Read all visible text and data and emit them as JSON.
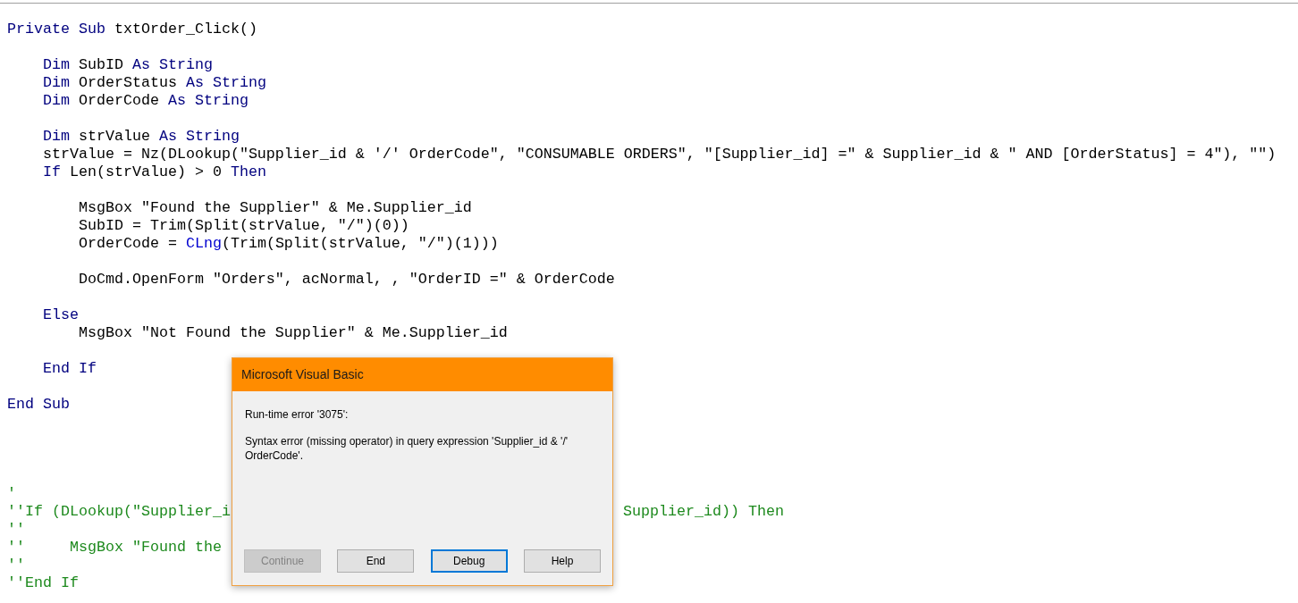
{
  "code": {
    "blocks": [
      [
        [
          {
            "kind": "keyword",
            "text": "Private Sub"
          },
          {
            "kind": "plain",
            "text": " txtOrder_Click()"
          }
        ]
      ],
      [
        [
          {
            "kind": "keyword",
            "text": "    Dim"
          },
          {
            "kind": "plain",
            "text": " SubID "
          },
          {
            "kind": "keyword",
            "text": "As String"
          }
        ],
        [
          {
            "kind": "keyword",
            "text": "    Dim"
          },
          {
            "kind": "plain",
            "text": " OrderStatus "
          },
          {
            "kind": "keyword",
            "text": "As String"
          }
        ],
        [
          {
            "kind": "keyword",
            "text": "    Dim"
          },
          {
            "kind": "plain",
            "text": " OrderCode "
          },
          {
            "kind": "keyword",
            "text": "As String"
          }
        ]
      ],
      [
        [
          {
            "kind": "keyword",
            "text": "    Dim"
          },
          {
            "kind": "plain",
            "text": " strValue "
          },
          {
            "kind": "keyword",
            "text": "As String"
          }
        ],
        [
          {
            "kind": "plain",
            "text": "    strValue = Nz(DLookup(\"Supplier_id & '/' OrderCode\", \"CONSUMABLE ORDERS\", \"[Supplier_id] =\" & Supplier_id & \" AND [OrderStatus] = 4\"), \"\")"
          }
        ],
        [
          {
            "kind": "keyword",
            "text": "    If"
          },
          {
            "kind": "plain",
            "text": " Len(strValue) > 0 "
          },
          {
            "kind": "keyword",
            "text": "Then"
          }
        ]
      ],
      [
        [
          {
            "kind": "plain",
            "text": "        MsgBox \"Found the Supplier\" & Me.Supplier_id"
          }
        ],
        [
          {
            "kind": "plain",
            "text": "        SubID = Trim(Split(strValue, \"/\")(0))"
          }
        ],
        [
          {
            "kind": "plain",
            "text": "        OrderCode = "
          },
          {
            "kind": "builtin",
            "text": "CLng"
          },
          {
            "kind": "plain",
            "text": "(Trim(Split(strValue, \"/\")(1)))"
          }
        ]
      ],
      [
        [
          {
            "kind": "plain",
            "text": "        DoCmd.OpenForm \"Orders\", acNormal, , \"OrderID =\" & OrderCode"
          }
        ]
      ],
      [
        [
          {
            "kind": "keyword",
            "text": "    Else"
          }
        ],
        [
          {
            "kind": "plain",
            "text": "        MsgBox \"Not Found the Supplier\" & Me.Supplier_id"
          }
        ]
      ],
      [
        [
          {
            "kind": "keyword",
            "text": "    End If"
          }
        ]
      ],
      [
        [
          {
            "kind": "keyword",
            "text": "End Sub"
          }
        ]
      ]
    ],
    "comment_lines": [
      {
        "segments": [
          "'"
        ]
      },
      {
        "segments": [
          "''If (DLookup(\"Supplier_i",
          "Supplier_id)) Then"
        ]
      },
      {
        "segments": [
          "''"
        ]
      },
      {
        "segments": [
          "''     MsgBox \"Found the"
        ]
      },
      {
        "segments": [
          "''"
        ]
      },
      {
        "segments": [
          "''End If"
        ]
      }
    ]
  },
  "dialog": {
    "title": "Microsoft Visual Basic",
    "error": "Run-time error '3075':",
    "message": "Syntax error (missing operator) in query expression 'Supplier_id & '/' OrderCode'.",
    "buttons": [
      {
        "label": "Continue",
        "disabled": true,
        "focused": false
      },
      {
        "label": "End",
        "disabled": false,
        "focused": false
      },
      {
        "label": "Debug",
        "disabled": false,
        "focused": true
      },
      {
        "label": "Help",
        "disabled": false,
        "focused": false
      }
    ]
  }
}
